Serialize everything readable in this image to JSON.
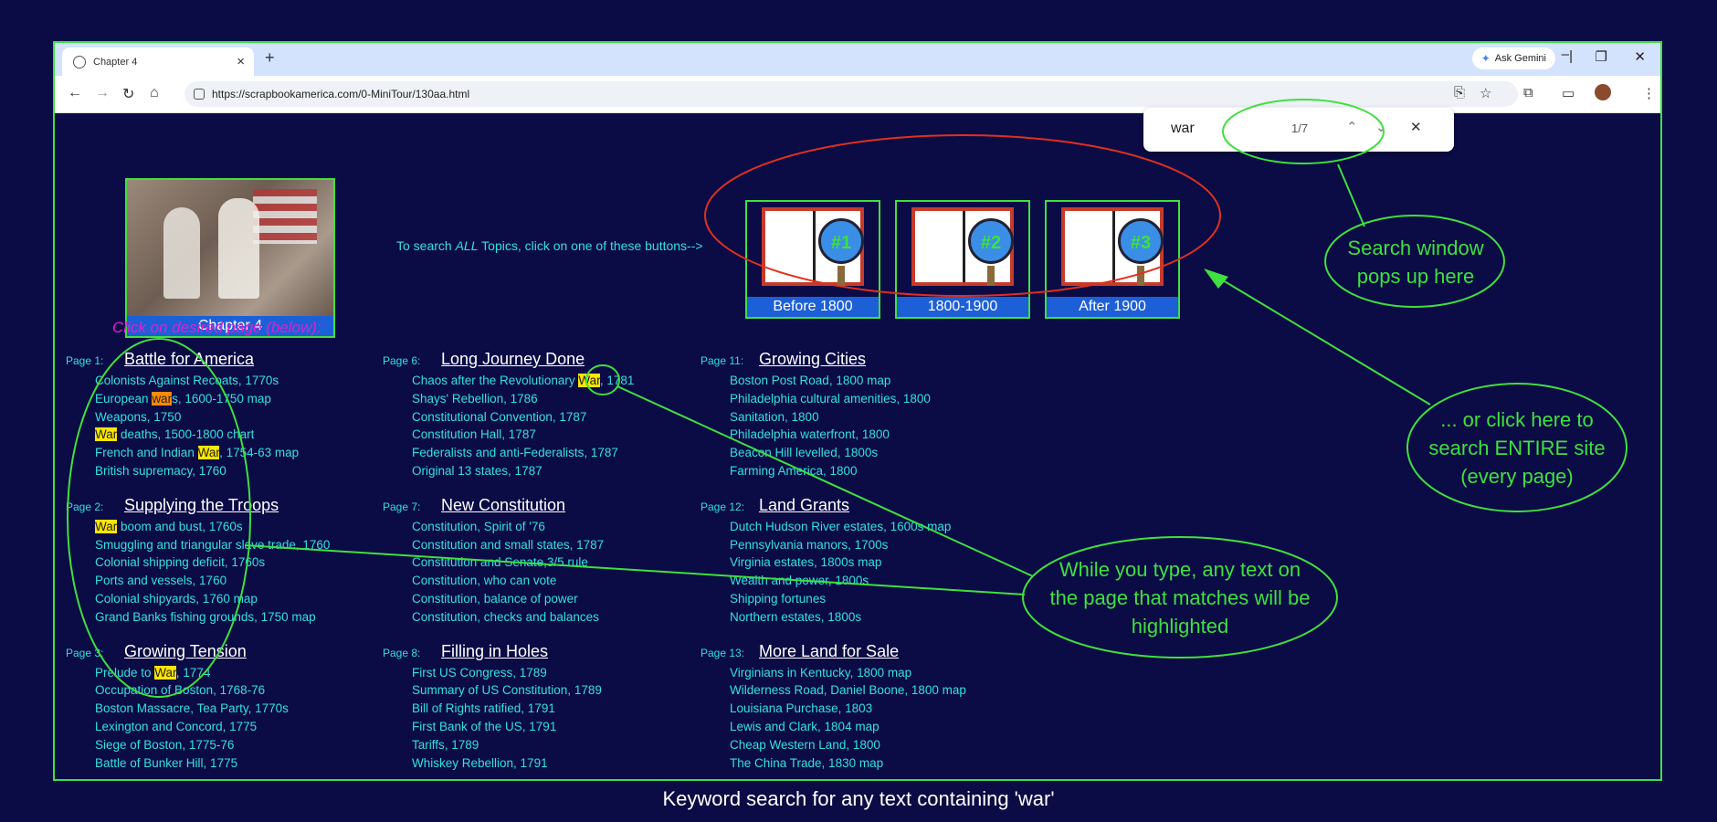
{
  "browser": {
    "tab_title": "Chapter 4",
    "url": "https://scrapbookamerica.com/0-MiniTour/130aa.html",
    "gemini_label": "Ask Gemini"
  },
  "find": {
    "query": "war",
    "count": "1/7"
  },
  "chapter_image_caption": "Chapter 4",
  "search_all": {
    "prefix": "To search ",
    "emph": "ALL",
    "suffix": " Topics, click on one of these buttons-->"
  },
  "search_buttons": [
    {
      "num": "#1",
      "label": "Before 1800"
    },
    {
      "num": "#2",
      "label": "1800-1900"
    },
    {
      "num": "#3",
      "label": "After 1900"
    }
  ],
  "click_desired": "Click on desired page (below):",
  "columns": [
    [
      {
        "page": "Page 1:",
        "title": "Battle for America",
        "items": [
          "Colonists Against Recoats, 1770s",
          "European wars, 1600-1750 map",
          "Weapons, 1750",
          "War deaths, 1500-1800 chart",
          "French and Indian War, 1754-63 map",
          "British supremacy, 1760"
        ]
      },
      {
        "page": "Page 2:",
        "title": "Supplying the Troops",
        "items": [
          "War boom and bust, 1760s",
          "Smuggling and triangular slave trade, 1760",
          "Colonial shipping deficit, 1760s",
          "Ports and vessels, 1760",
          "Colonial shipyards, 1760 map",
          "Grand Banks fishing grounds, 1750 map"
        ]
      },
      {
        "page": "Page 3:",
        "title": "Growing Tension",
        "items": [
          "Prelude to War, 1774",
          "Occupation of Boston, 1768-76",
          "Boston Massacre, Tea Party, 1770s",
          "Lexington and Concord, 1775",
          "Siege of Boston, 1775-76",
          "Battle of Bunker Hill, 1775"
        ]
      }
    ],
    [
      {
        "page": "Page 6:",
        "title": "Long Journey Done",
        "items": [
          "Chaos after the Revolutionary War, 1781",
          "Shays' Rebellion, 1786",
          "Constitutional Convention, 1787",
          "Constitution Hall, 1787",
          "Federalists and anti-Federalists, 1787",
          "Original 13 states, 1787"
        ]
      },
      {
        "page": "Page 7:",
        "title": "New Constitution",
        "items": [
          "Constitution, Spirit of '76",
          "Constitution and small states, 1787",
          "Constitution and Senate,3/5 rule",
          "Constitution, who can vote",
          "Constitution, balance of power",
          "Constitution, checks and balances"
        ]
      },
      {
        "page": "Page 8:",
        "title": "Filling in Holes",
        "items": [
          "First US Congress, 1789",
          "Summary of US Constitution, 1789",
          "Bill of Rights ratified, 1791",
          "First Bank of the US, 1791",
          "Tariffs, 1789",
          "Whiskey Rebellion, 1791"
        ]
      }
    ],
    [
      {
        "page": "Page 11:",
        "title": "Growing Cities",
        "items": [
          "Boston Post Road, 1800 map",
          "Philadelphia cultural amenities, 1800",
          "Sanitation, 1800",
          "Philadelphia waterfront, 1800",
          "Beacon Hill levelled, 1800s",
          "Farming America, 1800"
        ]
      },
      {
        "page": "Page 12:",
        "title": "Land Grants",
        "items": [
          "Dutch Hudson River estates, 1600s map",
          "Pennsylvania manors, 1700s",
          "Virginia estates, 1800s map",
          "Wealth and power, 1800s",
          "Shipping fortunes",
          "Northern estates, 1800s"
        ]
      },
      {
        "page": "Page 13:",
        "title": "More Land for Sale",
        "items": [
          "Virginians in Kentucky, 1800 map",
          "Wilderness Road, Daniel Boone, 1800 map",
          "Louisiana Purchase, 1803",
          "Lewis and Clark, 1804 map",
          "Cheap Western Land, 1800",
          "The China Trade, 1830 map"
        ]
      }
    ]
  ],
  "annotations": {
    "search_window": "Search window pops up here",
    "entire_site": "... or click here to search ENTIRE site (every page)",
    "highlight": "While you type, any text on the page that matches will be highlighted"
  },
  "caption": "Keyword search for any text containing 'war'",
  "colors": {
    "accent_green": "#3fe03f",
    "highlight": "#ffe600",
    "current_highlight": "#ff8a00",
    "ellipse_red": "#e03020"
  }
}
